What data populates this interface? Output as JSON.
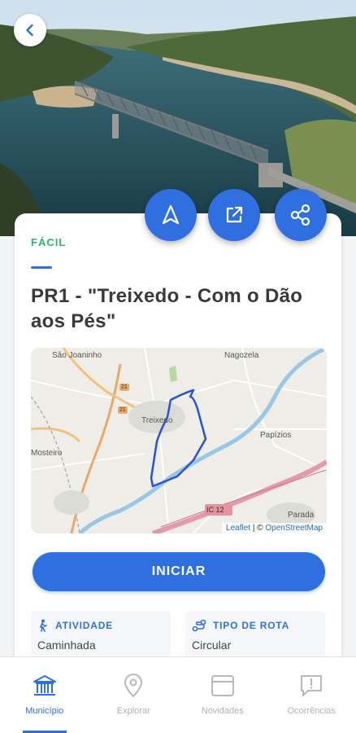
{
  "route": {
    "difficulty": "FÁCIL",
    "title": "PR1 - \"Treixedo - Com o Dão aos Pés\"",
    "start_label": "INICIAR",
    "activity_label": "ATIVIDADE",
    "activity_value": "Caminhada",
    "route_type_label": "TIPO DE ROTA",
    "route_type_value": "Circular"
  },
  "map": {
    "places": [
      "São Joaninho",
      "Nagozela",
      "Treixedo",
      "Papízios",
      "Mosteiro",
      "Parada"
    ],
    "road_labels": [
      "IC 12",
      "21"
    ],
    "attribution_leaflet": "Leaflet",
    "attribution_sep": " | © ",
    "attribution_osm": "OpenStreetMap"
  },
  "actions": [
    "navigate-icon",
    "external-link-icon",
    "share-icon"
  ],
  "nav": {
    "items": [
      {
        "label": "Município",
        "active": true
      },
      {
        "label": "Explorar",
        "active": false
      },
      {
        "label": "Novidades",
        "active": false
      },
      {
        "label": "Ocorrências",
        "active": false
      }
    ]
  },
  "colors": {
    "accent": "#2f6fe0",
    "difficulty": "#2db66e",
    "route": "#2a52d6"
  }
}
